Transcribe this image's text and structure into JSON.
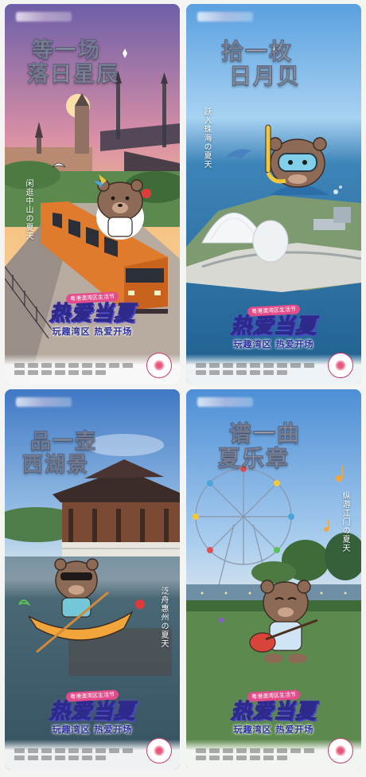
{
  "posters": [
    {
      "headline_lines": [
        "等一场",
        "落日星辰"
      ],
      "side_text": "闲逛中山の夏天",
      "scene": "sunset-train"
    },
    {
      "headline_lines": [
        "拾一枚",
        "日月贝"
      ],
      "side_text": "跃入珠海の夏天",
      "scene": "sea-shells"
    },
    {
      "headline_lines": [
        "品一壶",
        "西湖景"
      ],
      "side_text": "泛舟惠州の夏天",
      "scene": "lake-pavilion"
    },
    {
      "headline_lines": [
        "谱一曲",
        "夏乐章"
      ],
      "side_text": "纵游江门の夏天",
      "scene": "ferris-park"
    }
  ],
  "brand": {
    "tag": "粤港澳湾区生活节",
    "title": "热爱当夏",
    "subtitle": "玩趣湾区  热爱开场"
  },
  "colors": {
    "brand_ink": "#2d2a8c",
    "brand_pink": "#e34b8a",
    "bear_brown": "#8d6a55"
  }
}
